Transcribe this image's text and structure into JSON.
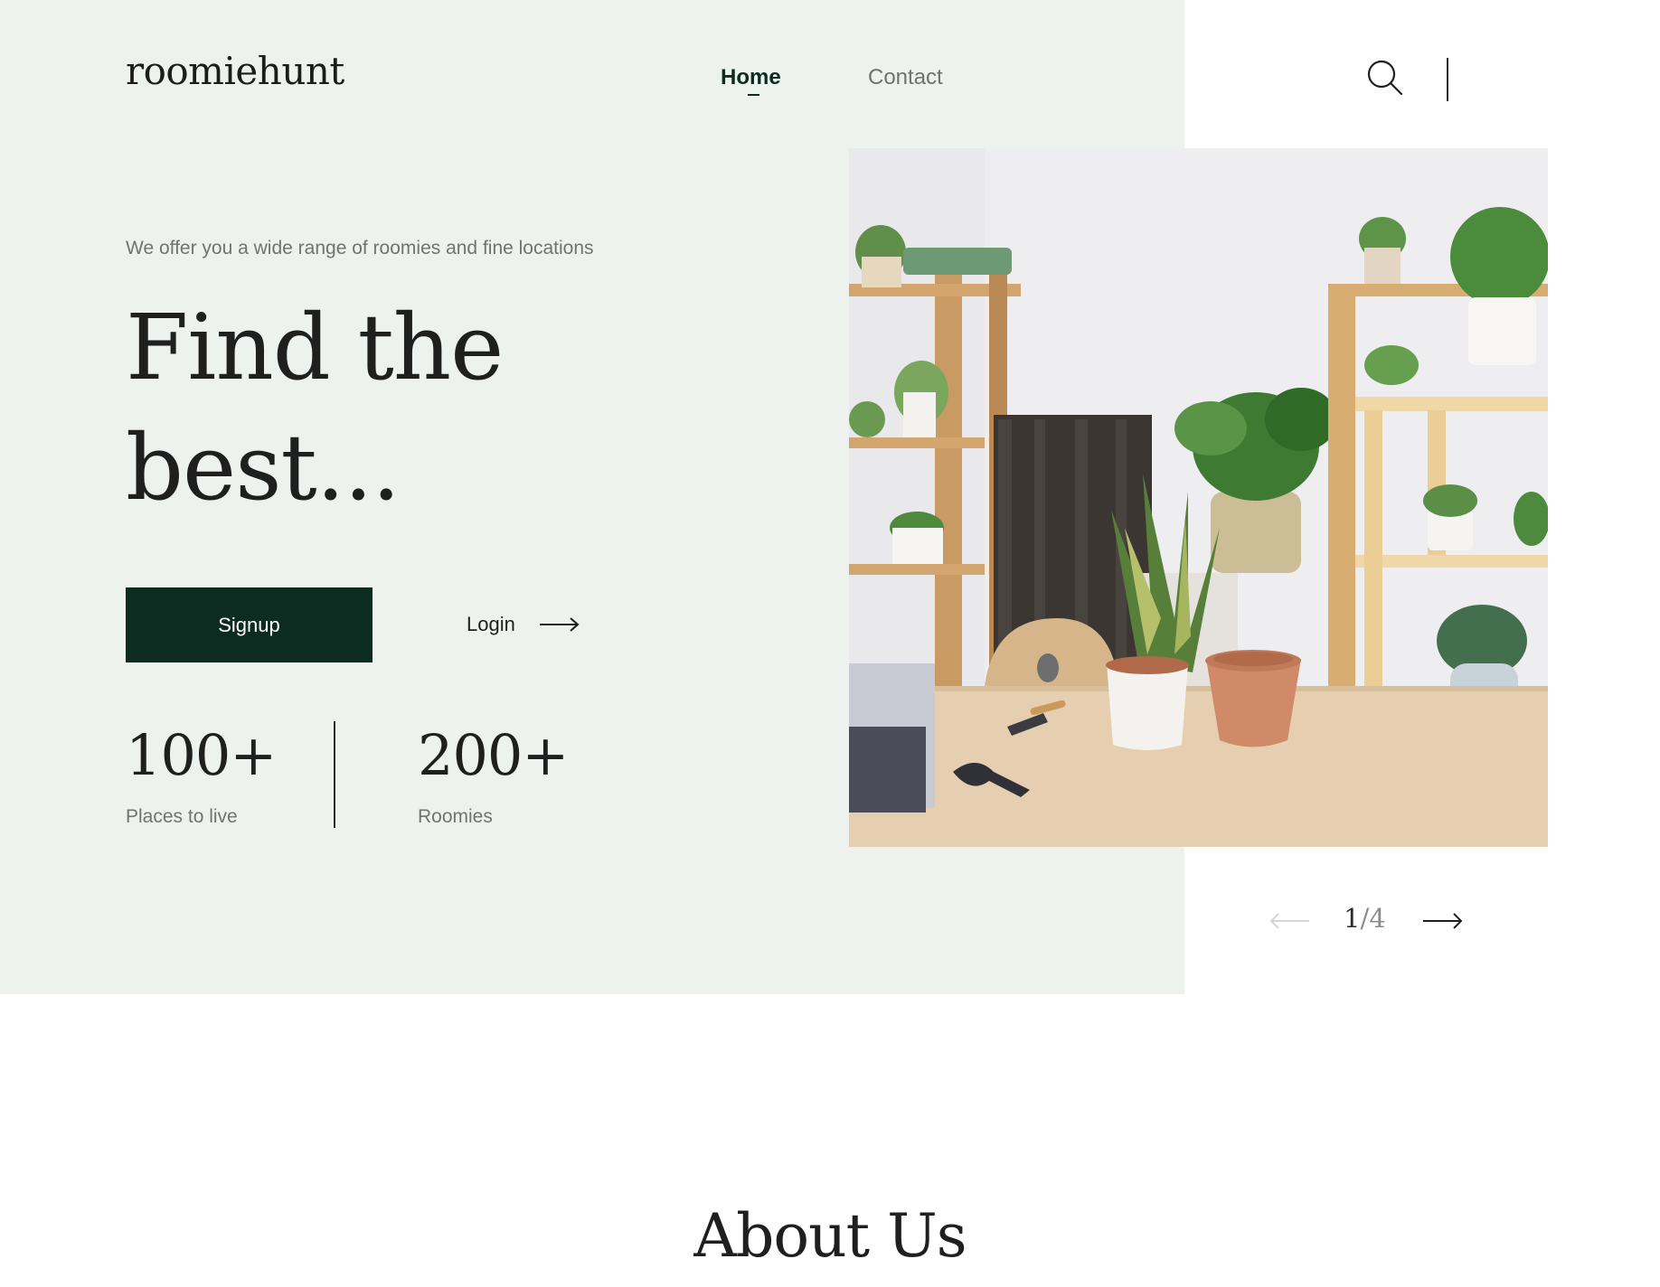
{
  "header": {
    "logo": "roomiehunt",
    "nav": [
      {
        "label": "Home",
        "active": true
      },
      {
        "label": "Contact",
        "active": false
      }
    ],
    "search_icon": "search-icon"
  },
  "hero": {
    "tagline": "We offer you a wide range of roomies and fine locations",
    "headline_line1": "Find the",
    "headline_line2": "best...",
    "signup_label": "Signup",
    "login_label": "Login",
    "stats": [
      {
        "value": "100+",
        "label": "Places to live"
      },
      {
        "value": "200+",
        "label": "Roomies"
      }
    ],
    "image_icon": "plants-on-shelves-photo"
  },
  "pager": {
    "current": "1",
    "separator": "/",
    "total": "4",
    "prev_icon": "arrow-left-icon",
    "next_icon": "arrow-right-icon"
  },
  "about": {
    "title": "About Us"
  },
  "colors": {
    "hero_background": "#eef2ef",
    "accent_dark_green": "#0c2b21",
    "muted_text": "#6f7470"
  }
}
